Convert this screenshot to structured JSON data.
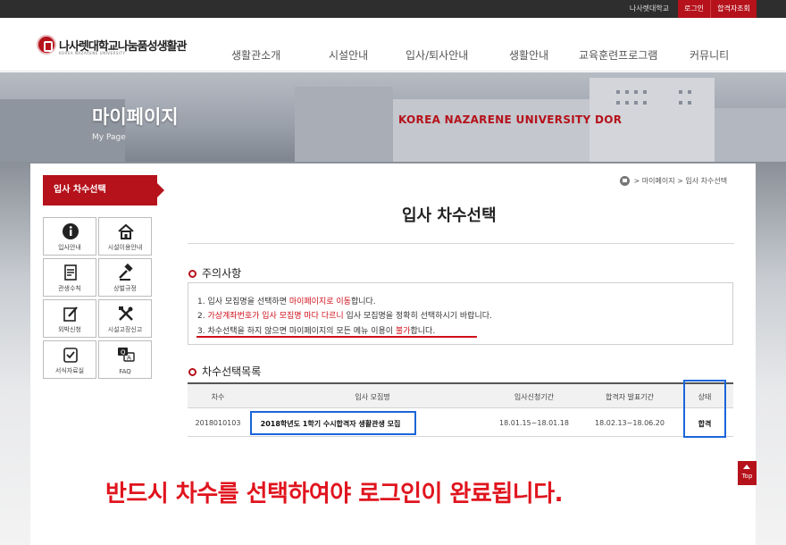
{
  "topbar": {
    "univ_link": "나사렛대학교",
    "login": "로그인",
    "result_lookup": "합격자조회"
  },
  "logo": {
    "name": "나사렛대학교나눔품성생활관",
    "name_en": "KOREA NAZARENE UNIVERSITY"
  },
  "gnb": [
    "생활관소개",
    "시설안내",
    "입사/퇴사안내",
    "생활안내",
    "교육훈련프로그램",
    "커뮤니티"
  ],
  "banner": {
    "title": "마이페이지",
    "subtitle": "My Page",
    "tagline": "KOREA NAZARENE UNIVERSITY DOR"
  },
  "sidebar": {
    "active": "입사 차수선택",
    "items": [
      {
        "label": "입사안내",
        "icon": "info-icon"
      },
      {
        "label": "시설이용안내",
        "icon": "home-icon"
      },
      {
        "label": "관생수칙",
        "icon": "checklist-icon"
      },
      {
        "label": "상벌규정",
        "icon": "rules-icon"
      },
      {
        "label": "외박신청",
        "icon": "edit-icon"
      },
      {
        "label": "시설고장신고",
        "icon": "tools-icon"
      },
      {
        "label": "서식자료실",
        "icon": "form-icon"
      },
      {
        "label": "FAQ",
        "icon": "faq-icon"
      }
    ]
  },
  "breadcrumb": {
    "sep": ">",
    "level1": "마이페이지",
    "level2": "입사 차수선택"
  },
  "page_title": "입사 차수선택",
  "notice": {
    "heading": "주의사항",
    "line1": {
      "a": "1. 입사 모집명을 선택하면 ",
      "b": "마이페이지로 이동",
      "c": "합니다."
    },
    "line2": {
      "a": "2. ",
      "b": "가상계좌번호가 입사 모집명 마다 다르니",
      "c": " 입사 모집명을 정확히 선택하시기 바랍니다."
    },
    "line3": {
      "a": "3. 차수선택을 하지 않으면 마이페이지의 모든 메뉴 이용이 ",
      "b": "불가",
      "c": "합니다."
    }
  },
  "list": {
    "heading": "차수선택목록",
    "columns": [
      "차수",
      "입사 모집명",
      "입사신청기간",
      "합격자 발표기간",
      "상태"
    ],
    "rows": [
      {
        "round": "2018010103",
        "name": "2018학년도 1학기 수시합격자 생활관생 모집",
        "apply": "18.01.15~18.01.18",
        "announce": "18.02.13~18.06.20",
        "status": "합격"
      }
    ]
  },
  "callout": "반드시 차수를 선택하여야 로그인이 완료됩니다.",
  "top_button": "Top",
  "colors": {
    "brand": "#b5121b",
    "callout": "#e0141e",
    "highlight_box": "#1a66d9"
  }
}
